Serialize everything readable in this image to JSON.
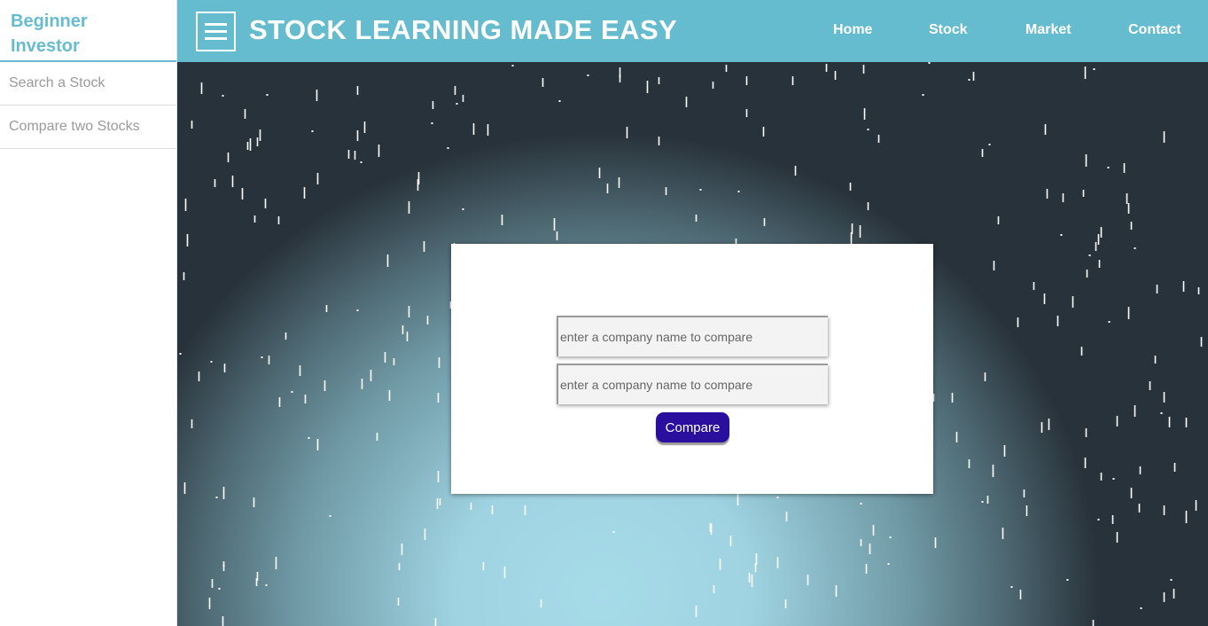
{
  "sidebar": {
    "brand": "Beginner Investor",
    "items": [
      {
        "label": "Search a Stock"
      },
      {
        "label": "Compare two Stocks"
      }
    ]
  },
  "header": {
    "title": "STOCK LEARNING MADE EASY",
    "nav": [
      {
        "label": "Home"
      },
      {
        "label": "Stock"
      },
      {
        "label": "Market"
      },
      {
        "label": "Contact"
      }
    ]
  },
  "compare_form": {
    "first_company": {
      "value": "",
      "placeholder": "enter a company name to compare"
    },
    "second_company": {
      "value": "",
      "placeholder": "enter a company name to compare"
    },
    "submit_label": "Compare"
  },
  "colors": {
    "brand": "#66bccf",
    "button": "#2a0f9e"
  },
  "icons": [
    "hamburger-menu-icon"
  ]
}
